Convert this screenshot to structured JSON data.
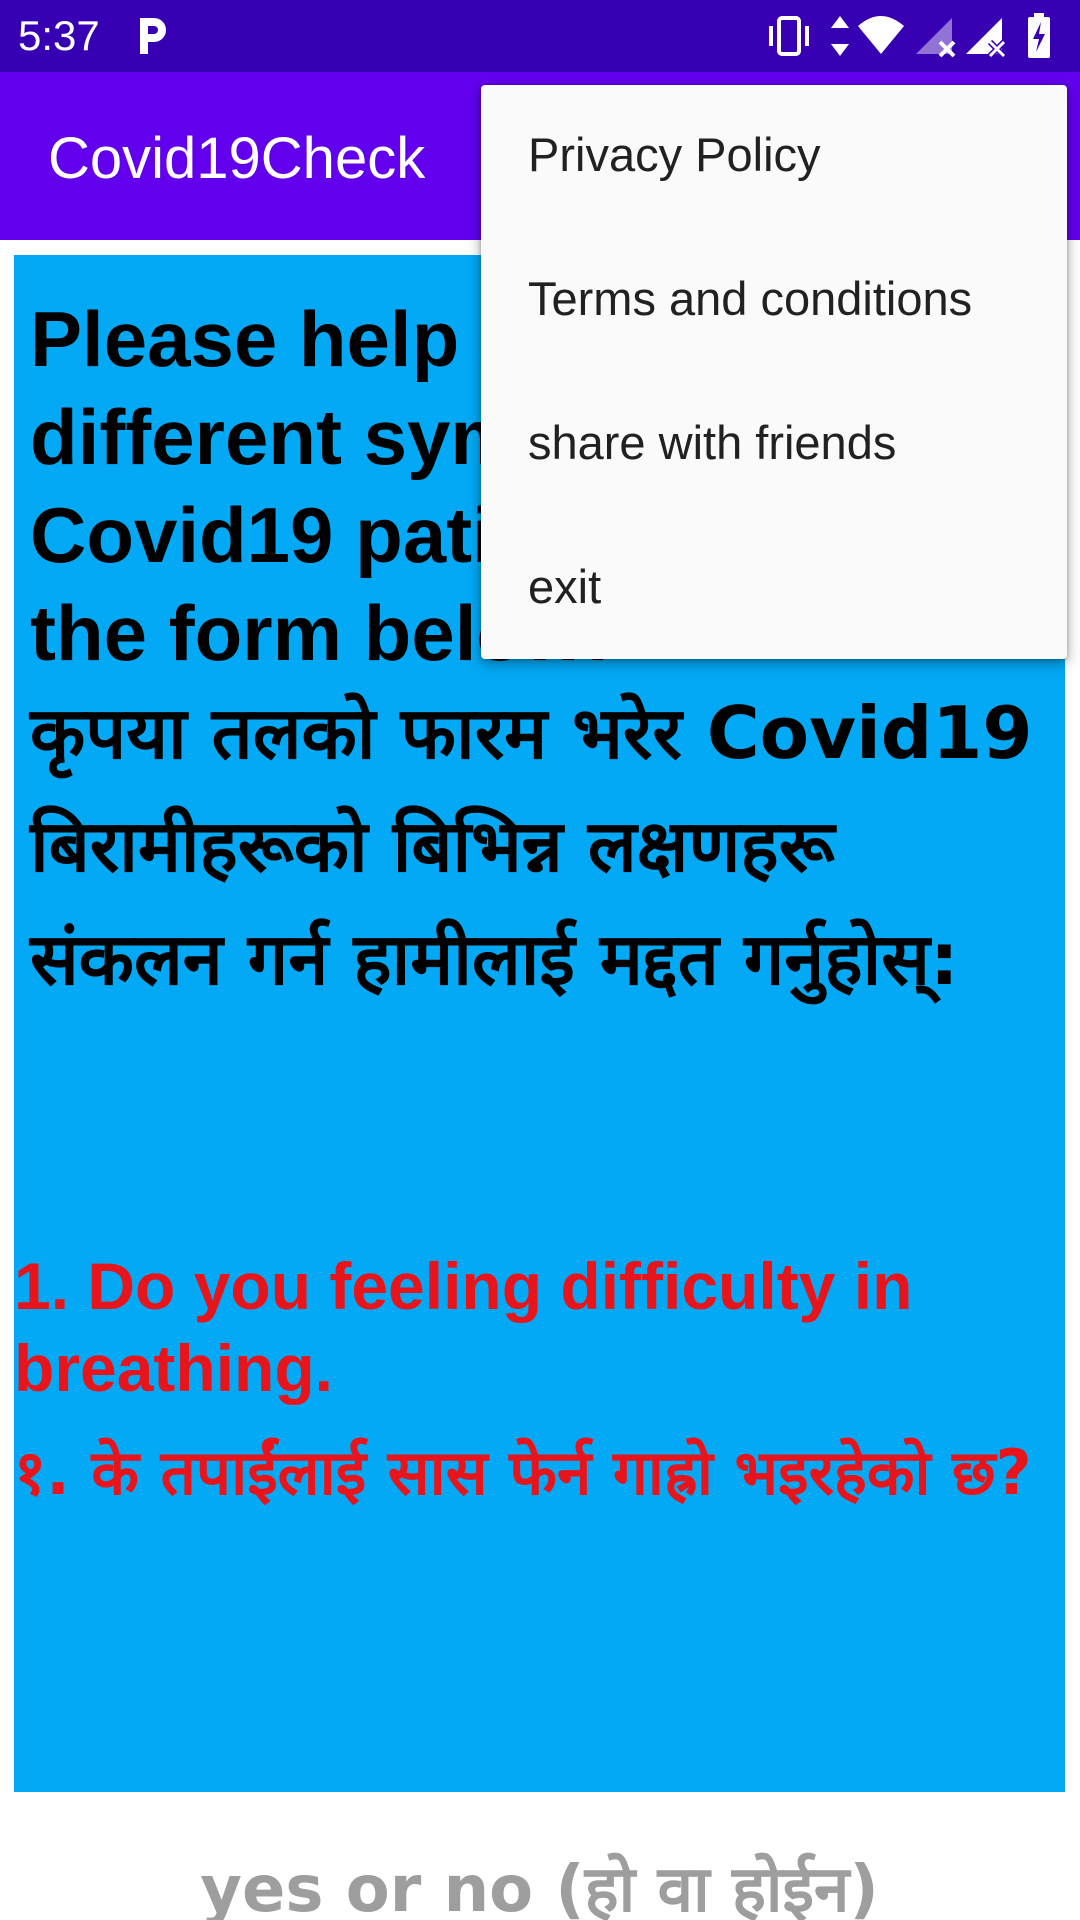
{
  "status_bar": {
    "time": "5:37",
    "icons": [
      "parking-icon",
      "vibrate-icon",
      "data-arrows-icon",
      "wifi-icon",
      "signal-x-icon",
      "signal-x-icon-2",
      "battery-charging-icon"
    ]
  },
  "app_bar": {
    "title": "Covid19Check",
    "color": "#6200ee"
  },
  "content": {
    "intro_en": "Please help us collect different symptoms of Covid19 patients by filling the form below:",
    "intro_np": "कृपया तलको फारम भरेर Covid19  बिरामीहरूको बिभिन्न लक्षणहरू संकलन गर्न हामीलाई मद्दत गर्नुहोस्:",
    "question_en": "1. Do you feeling difficulty in breathing.",
    "question_np": "१. के तपाईंलाई सास फेर्न गाह्रो भइरहेको छ?",
    "answer_label": "yes or no (हो वा होईन)",
    "panel_color": "#03a9f4",
    "question_color": "#e8141b"
  },
  "menu": {
    "items": [
      {
        "label": "Privacy Policy"
      },
      {
        "label": "Terms and conditions"
      },
      {
        "label": "share with friends"
      },
      {
        "label": "exit"
      }
    ]
  }
}
